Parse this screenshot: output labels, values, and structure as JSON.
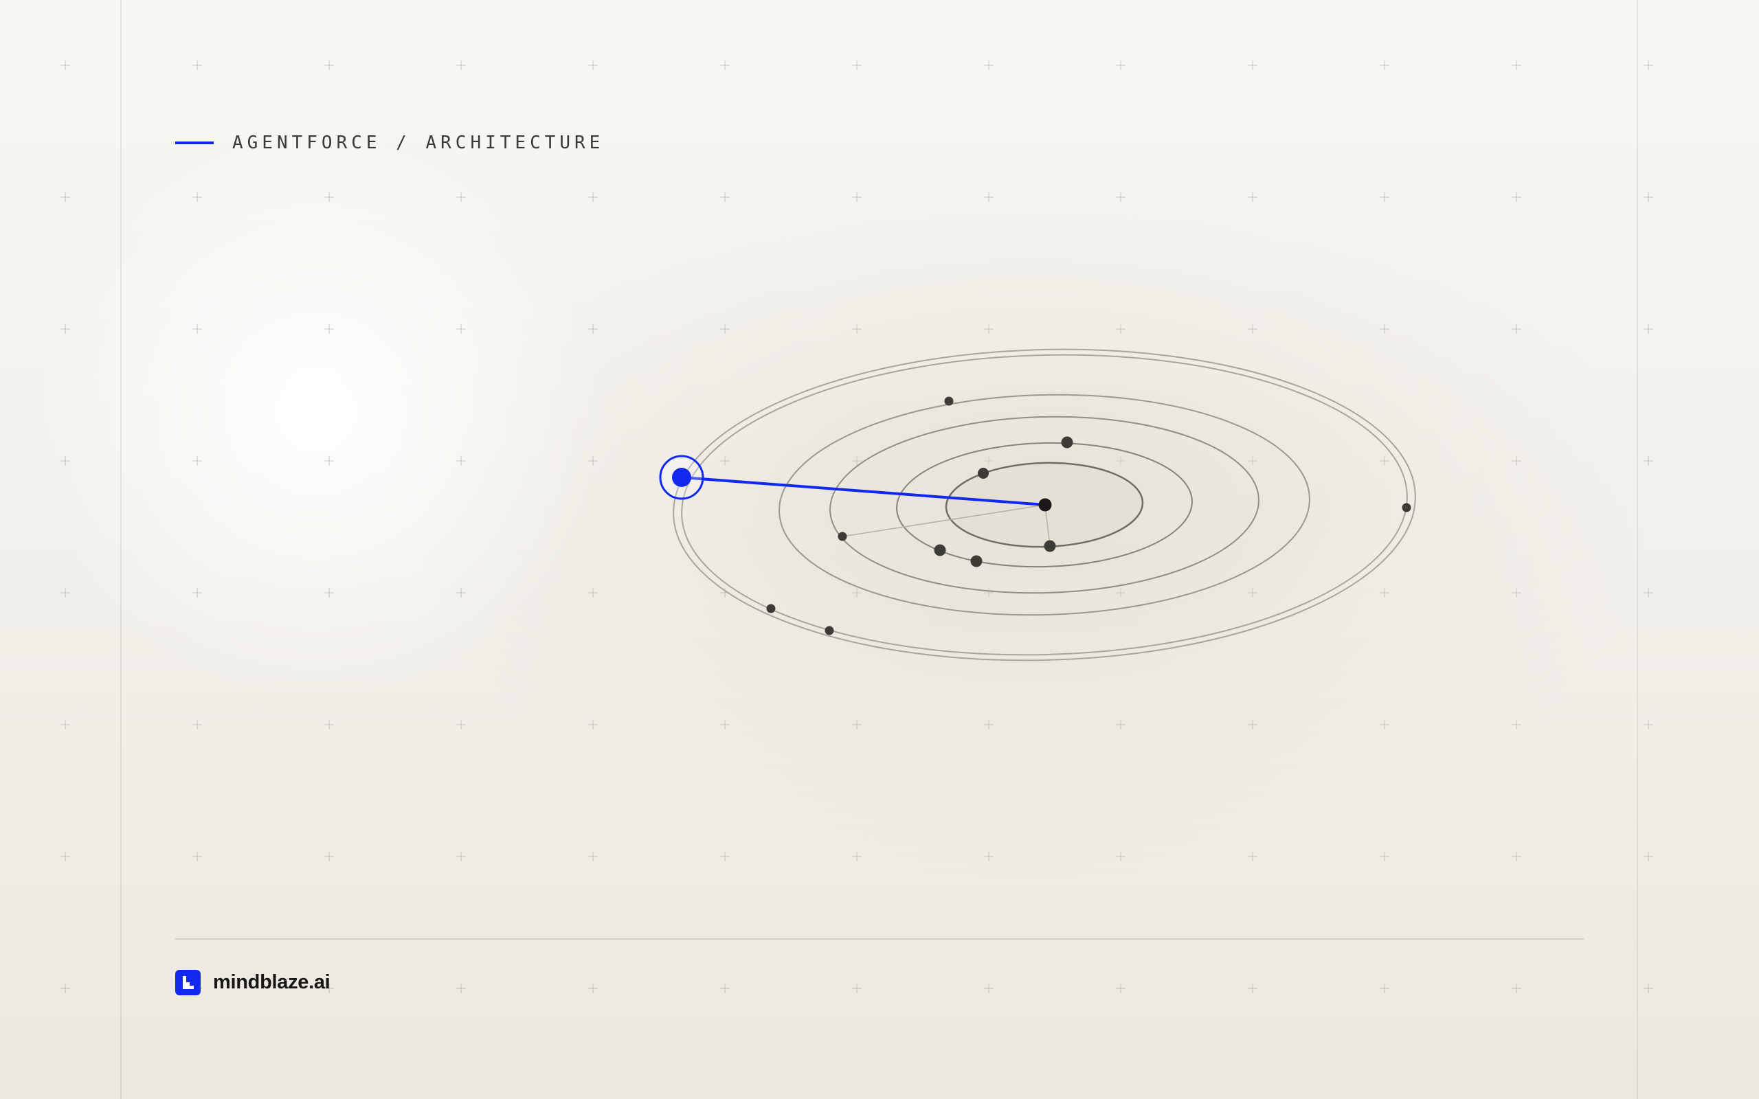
{
  "header": {
    "title": "AGENTFORCE / ARCHITECTURE"
  },
  "footer": {
    "brand_name": "mindblaze.ai",
    "logo_icon": "mindblaze-logo-icon"
  },
  "colors": {
    "accent": "#1129ee",
    "ring": "#8f8c86",
    "node": "#3c3b38",
    "background": "#f4f2ec"
  },
  "diagram": {
    "type": "orbital-architecture",
    "highlighted_node": "outer-agent-node",
    "ring_count": 5
  }
}
